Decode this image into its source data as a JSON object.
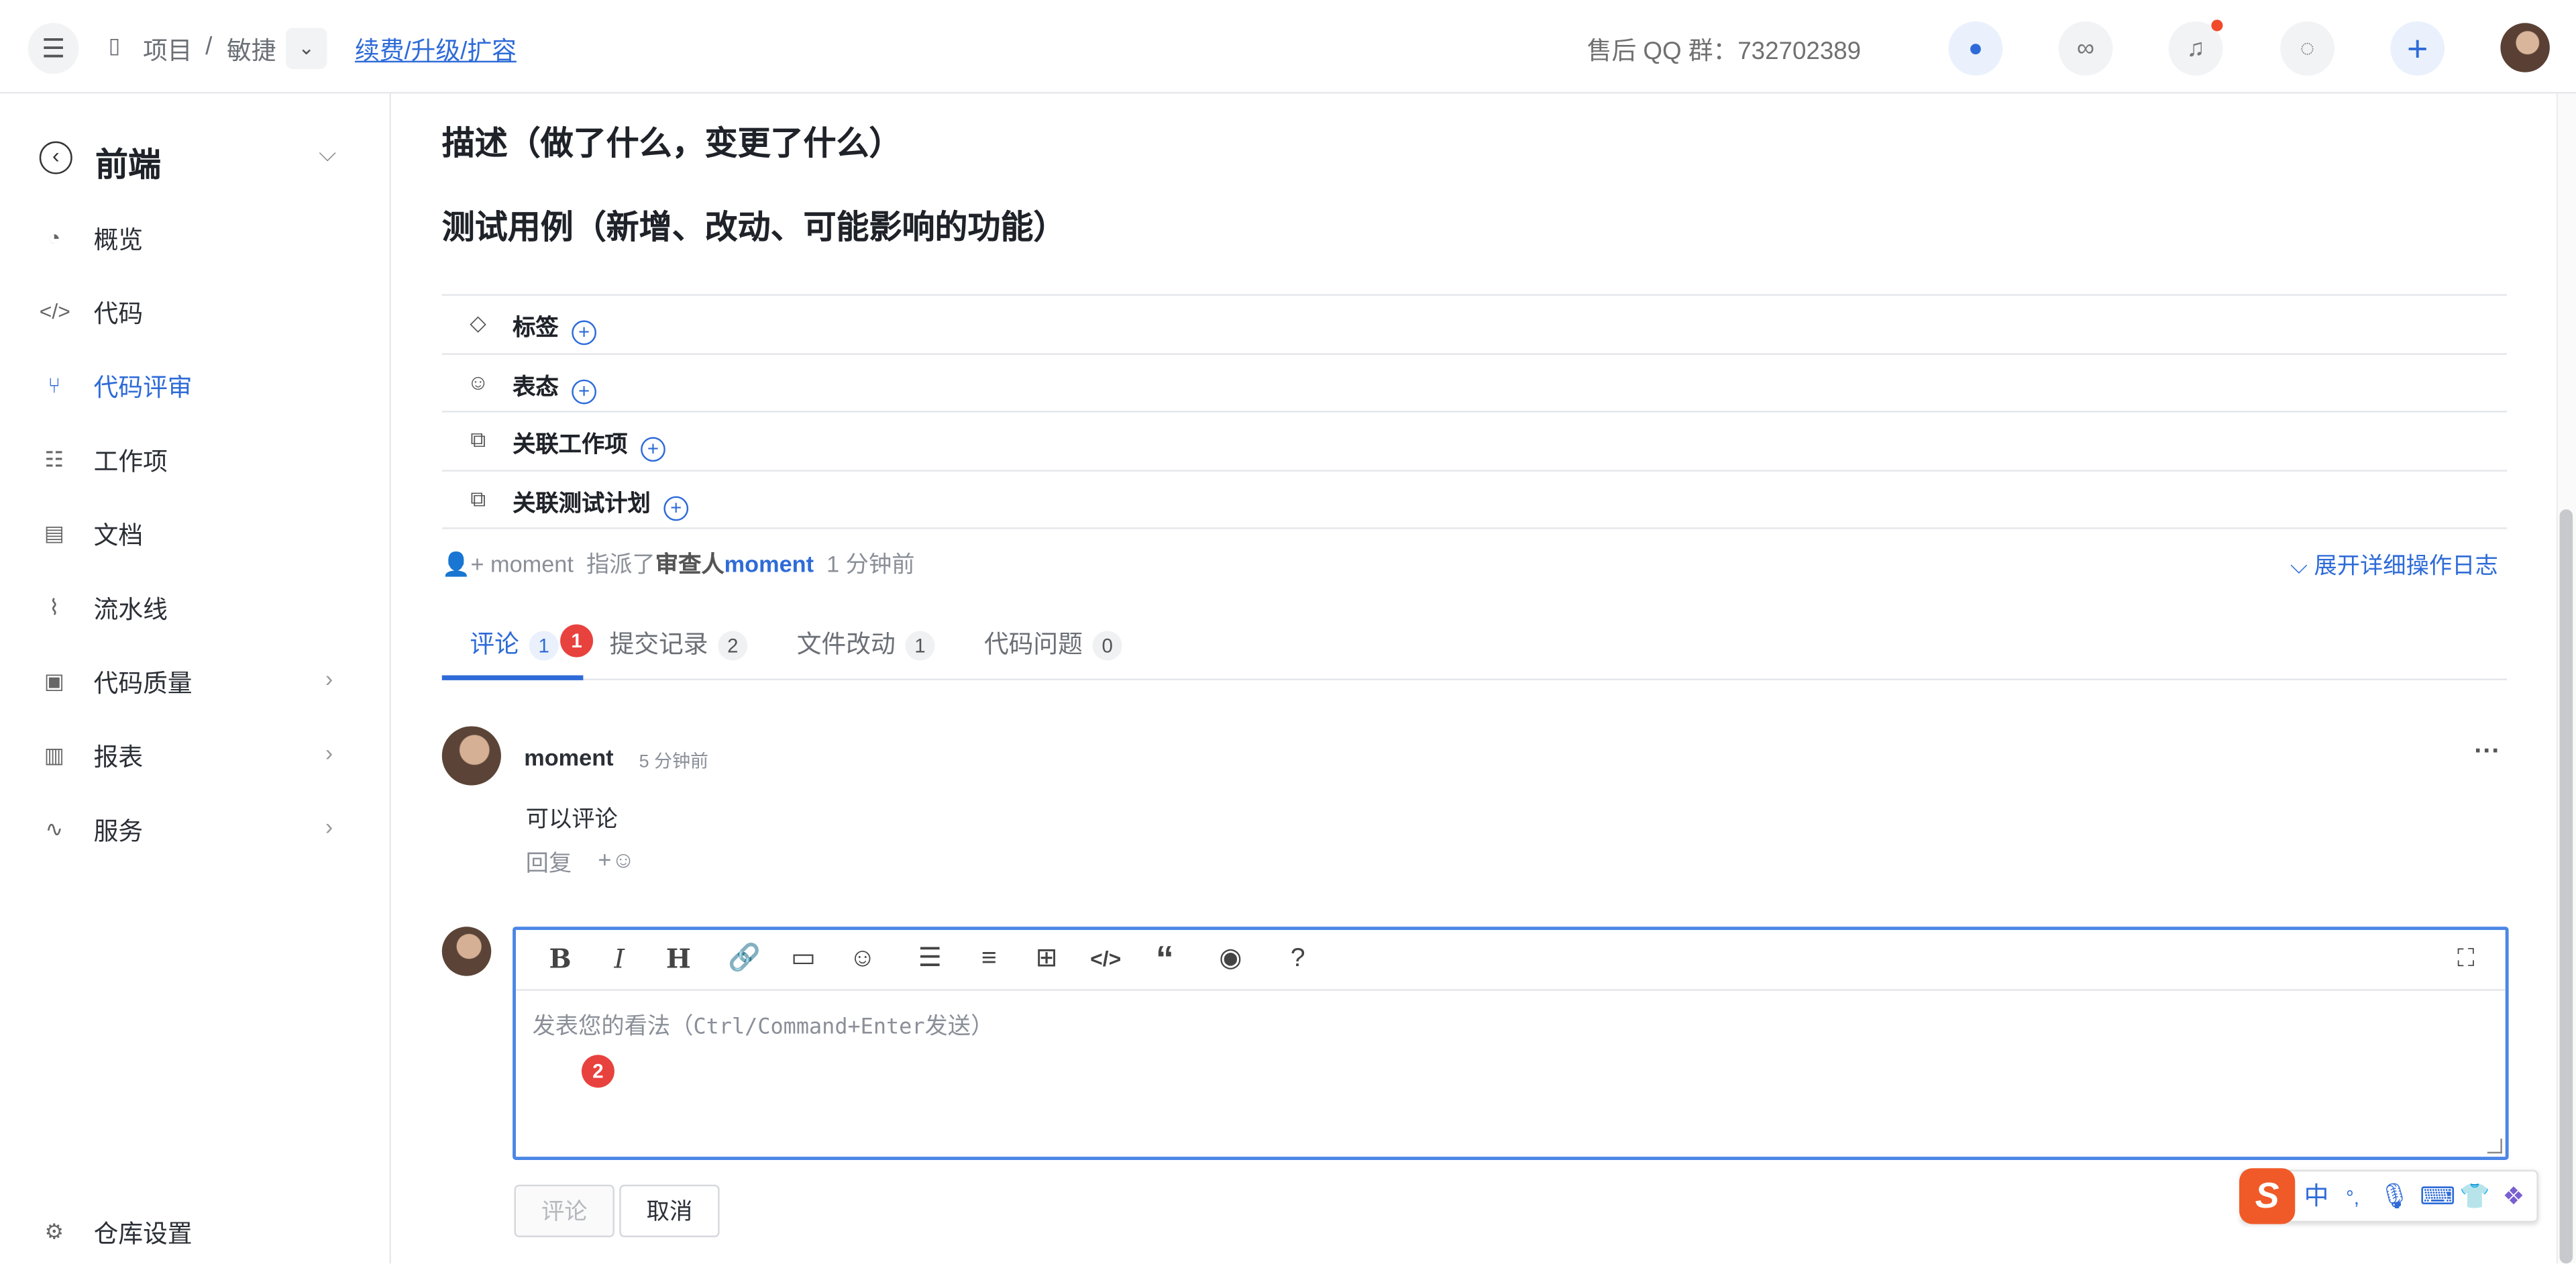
{
  "topbar": {
    "crumb_project": "项目",
    "crumb_sep": "/",
    "crumb_current": "敏捷",
    "renew_link": "续费/升级/扩容",
    "qq_group": "售后 QQ 群：732702389"
  },
  "sidebar": {
    "title": "前端",
    "items": [
      {
        "label": "概览",
        "icon": "gauge-icon"
      },
      {
        "label": "代码",
        "icon": "code-icon"
      },
      {
        "label": "代码评审",
        "icon": "merge-request-icon",
        "active": true
      },
      {
        "label": "工作项",
        "icon": "task-icon"
      },
      {
        "label": "文档",
        "icon": "book-icon"
      },
      {
        "label": "流水线",
        "icon": "pipeline-icon"
      },
      {
        "label": "代码质量",
        "icon": "quality-icon",
        "expandable": true
      },
      {
        "label": "报表",
        "icon": "chart-icon",
        "expandable": true
      },
      {
        "label": "服务",
        "icon": "pulse-icon",
        "expandable": true
      }
    ],
    "settings_label": "仓库设置"
  },
  "main": {
    "section_description": "描述（做了什么，变更了什么）",
    "section_testcases": "测试用例（新增、改动、可能影响的功能）",
    "fields": [
      {
        "label": "标签",
        "icon": "tag-icon"
      },
      {
        "label": "表态",
        "icon": "smile-icon"
      },
      {
        "label": "关联工作项",
        "icon": "link-items-icon"
      },
      {
        "label": "关联测试计划",
        "icon": "link-items-icon"
      }
    ],
    "activity": {
      "user": "moment",
      "action": "指派了",
      "role": "审查人",
      "target": "moment",
      "time": "1 分钟前"
    },
    "expand_log": "展开详细操作日志",
    "tabs": [
      {
        "label": "评论",
        "count": "1"
      },
      {
        "label": "提交记录",
        "count": "2"
      },
      {
        "label": "文件改动",
        "count": "1"
      },
      {
        "label": "代码问题",
        "count": "0"
      }
    ],
    "badges": {
      "one": "1",
      "two": "2"
    },
    "comment": {
      "author": "moment",
      "time": "5 分钟前",
      "body": "可以评论",
      "reply": "回复",
      "react": "+☺",
      "more": "···"
    },
    "editor": {
      "placeholder_prefix": "发表您的看法（",
      "placeholder_keys": "Ctrl/Command+Enter",
      "placeholder_suffix": "发送）"
    },
    "buttons": {
      "submit": "评论",
      "cancel": "取消"
    }
  },
  "ime": {
    "lang": "中",
    "punct": "°,",
    "logo": "S"
  },
  "colors": {
    "accent": "#2e6bd8",
    "badge": "#e8423f",
    "ime_logo": "#f05a28"
  }
}
